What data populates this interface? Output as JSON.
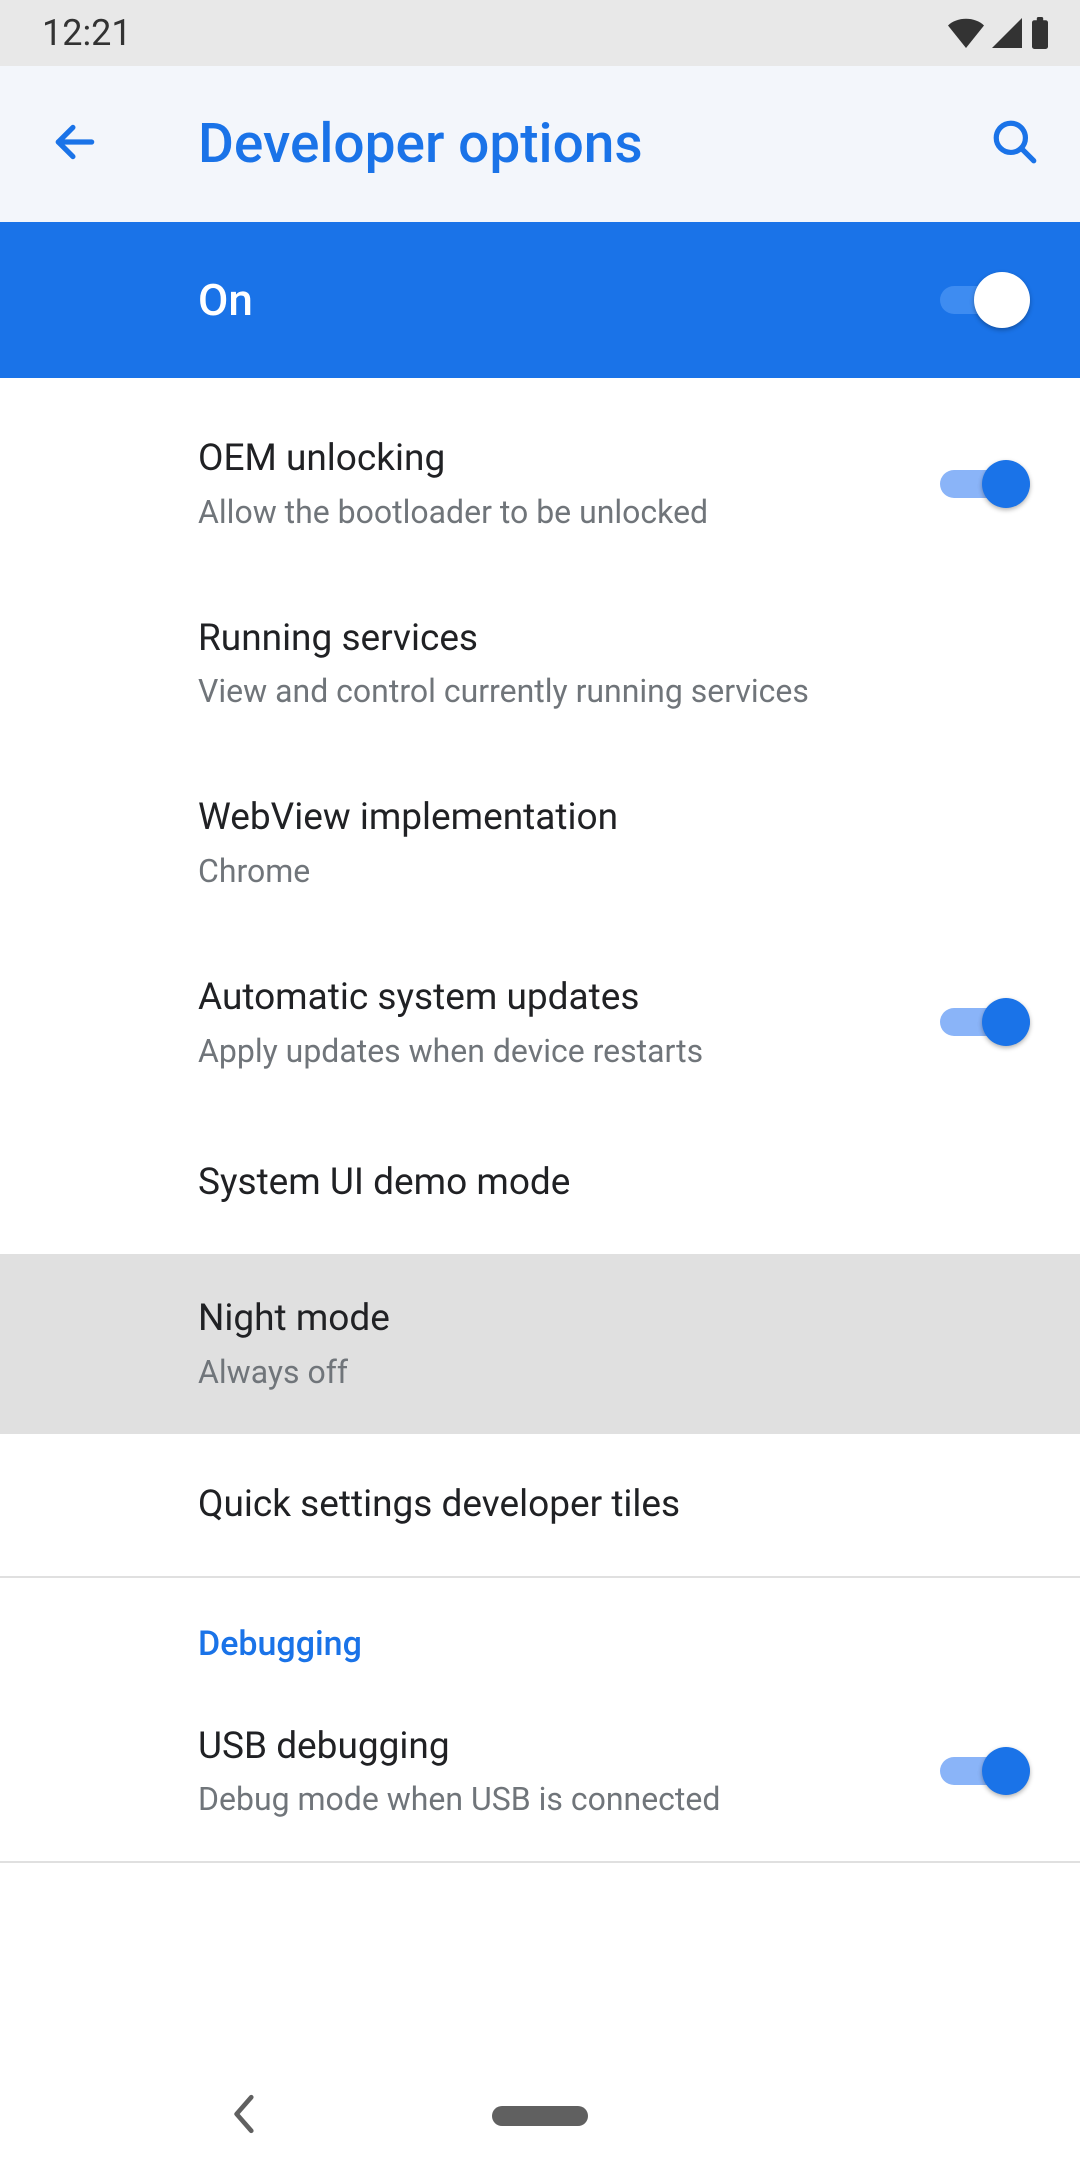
{
  "status": {
    "time": "12:21"
  },
  "appbar": {
    "title": "Developer options"
  },
  "master": {
    "label": "On",
    "on": true
  },
  "rows": {
    "oem": {
      "title": "OEM unlocking",
      "sub": "Allow the bootloader to be unlocked",
      "on": true
    },
    "running": {
      "title": "Running services",
      "sub": "View and control currently running services"
    },
    "webview": {
      "title": "WebView implementation",
      "sub": "Chrome"
    },
    "autoupd": {
      "title": "Automatic system updates",
      "sub": "Apply updates when device restarts",
      "on": true
    },
    "demomode": {
      "title": "System UI demo mode"
    },
    "night": {
      "title": "Night mode",
      "sub": "Always off"
    },
    "qstiles": {
      "title": "Quick settings developer tiles"
    },
    "usbdbg": {
      "title": "USB debugging",
      "sub": "Debug mode when USB is connected",
      "on": true
    }
  },
  "sections": {
    "debugging": "Debugging"
  }
}
